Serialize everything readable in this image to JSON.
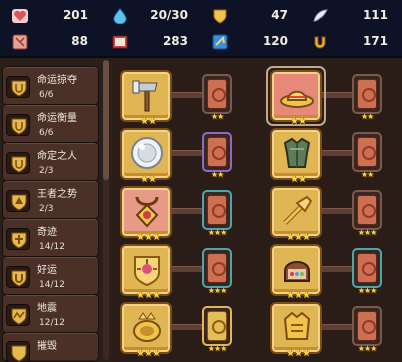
{
  "stats": [
    {
      "icon": "heart-icon",
      "value": "201",
      "color": "#e86a76"
    },
    {
      "icon": "drop-icon",
      "value": "20/30",
      "color": "#4fb7e8"
    },
    {
      "icon": "shield-icon",
      "value": "47",
      "color": "#f0c64a"
    },
    {
      "icon": "wing-icon",
      "value": "111",
      "color": "#e9eef5"
    },
    {
      "icon": "scroll-icon",
      "value": "88",
      "color": "#e79b86"
    },
    {
      "icon": "book-icon",
      "value": "283",
      "color": "#d64a4a"
    },
    {
      "icon": "card-icon",
      "value": "120",
      "color": "#3f8fd8"
    },
    {
      "icon": "horseshoe-icon",
      "value": "171",
      "color": "#f0b23a"
    }
  ],
  "abilities": [
    {
      "name": "命运掠夺",
      "progress": "6/6"
    },
    {
      "name": "命运衡量",
      "progress": "6/6"
    },
    {
      "name": "命定之人",
      "progress": "2/3"
    },
    {
      "name": "王者之势",
      "progress": "2/3"
    },
    {
      "name": "奇迹",
      "progress": "14/12"
    },
    {
      "name": "好运",
      "progress": "14/12"
    },
    {
      "name": "地震",
      "progress": "12/12"
    },
    {
      "name": "摧毁",
      "progress": ""
    }
  ],
  "items": {
    "left": [
      {
        "icon": "hammer-axe-icon",
        "stars": "★★"
      },
      {
        "icon": "silver-orb-icon",
        "stars": "★★"
      },
      {
        "icon": "amulet-icon",
        "stars": "★★★"
      },
      {
        "icon": "crest-icon",
        "stars": "★★★"
      },
      {
        "icon": "crown-ring-icon",
        "stars": "★★★"
      }
    ],
    "right": [
      {
        "icon": "straw-hat-icon",
        "stars": "★★"
      },
      {
        "icon": "green-armor-icon",
        "stars": "★★"
      },
      {
        "icon": "golden-trumpet-icon",
        "stars": "★★★"
      },
      {
        "icon": "sweets-box-icon",
        "stars": "★★★"
      },
      {
        "icon": "gold-armor-icon",
        "stars": "★★★"
      }
    ]
  },
  "cards": {
    "left": [
      {
        "style": "plain",
        "stars": "★★"
      },
      {
        "style": "purple",
        "stars": "★★"
      },
      {
        "style": "teal",
        "stars": "★★★"
      },
      {
        "style": "teal",
        "stars": "★★★"
      },
      {
        "style": "gold",
        "stars": "★★★"
      }
    ],
    "right": [
      {
        "style": "plain",
        "stars": "★★"
      },
      {
        "style": "plain",
        "stars": "★★"
      },
      {
        "style": "plain",
        "stars": "★★★"
      },
      {
        "style": "teal",
        "stars": "★★★"
      },
      {
        "style": "plain",
        "stars": "★★★"
      }
    ]
  }
}
